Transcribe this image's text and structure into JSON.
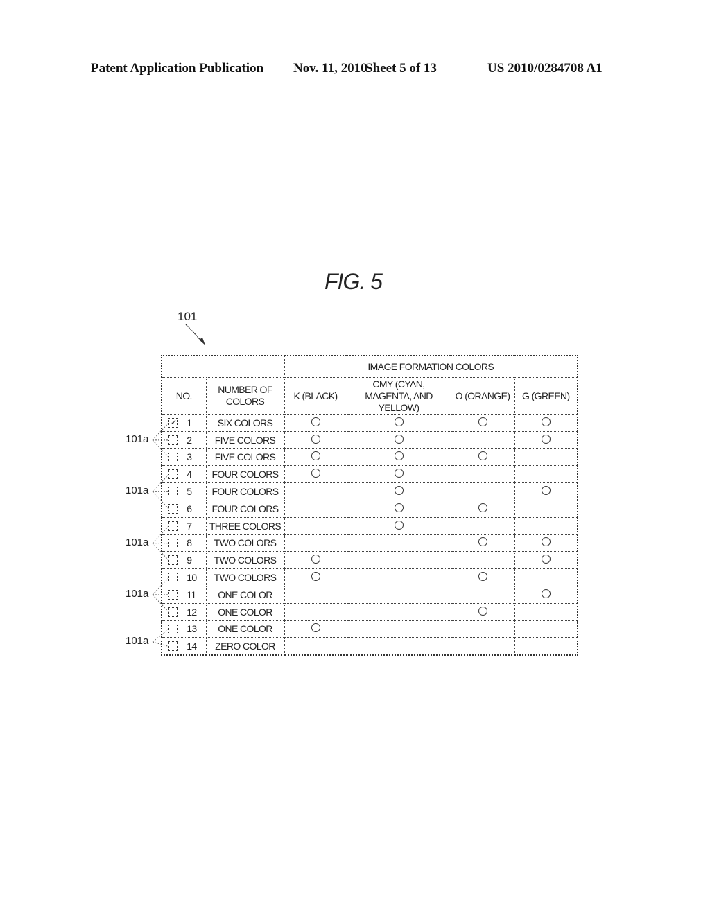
{
  "header": {
    "publication": "Patent Application Publication",
    "date": "Nov. 11, 2010",
    "sheet": "Sheet 5 of 13",
    "number": "US 2010/0284708 A1"
  },
  "figure": {
    "title": "FIG. 5",
    "ref_main": "101",
    "ref_checkbox": "101a"
  },
  "table": {
    "group_header": "IMAGE FORMATION COLORS",
    "columns": {
      "no": "NO.",
      "number_of_colors": "NUMBER OF COLORS",
      "k": "K (BLACK)",
      "cmy": "CMY (CYAN, MAGENTA, AND YELLOW)",
      "o": "O (ORANGE)",
      "g": "G (GREEN)"
    },
    "rows": [
      {
        "no": "1",
        "checked": true,
        "label": "SIX COLORS",
        "k": true,
        "cmy": true,
        "o": true,
        "g": true
      },
      {
        "no": "2",
        "checked": false,
        "label": "FIVE COLORS",
        "k": true,
        "cmy": true,
        "o": false,
        "g": true
      },
      {
        "no": "3",
        "checked": false,
        "label": "FIVE COLORS",
        "k": true,
        "cmy": true,
        "o": true,
        "g": false
      },
      {
        "no": "4",
        "checked": false,
        "label": "FOUR COLORS",
        "k": true,
        "cmy": true,
        "o": false,
        "g": false
      },
      {
        "no": "5",
        "checked": false,
        "label": "FOUR COLORS",
        "k": false,
        "cmy": true,
        "o": false,
        "g": true
      },
      {
        "no": "6",
        "checked": false,
        "label": "FOUR COLORS",
        "k": false,
        "cmy": true,
        "o": true,
        "g": false
      },
      {
        "no": "7",
        "checked": false,
        "label": "THREE COLORS",
        "k": false,
        "cmy": true,
        "o": false,
        "g": false
      },
      {
        "no": "8",
        "checked": false,
        "label": "TWO COLORS",
        "k": false,
        "cmy": false,
        "o": true,
        "g": true
      },
      {
        "no": "9",
        "checked": false,
        "label": "TWO COLORS",
        "k": true,
        "cmy": false,
        "o": false,
        "g": true
      },
      {
        "no": "10",
        "checked": false,
        "label": "TWO COLORS",
        "k": true,
        "cmy": false,
        "o": true,
        "g": false
      },
      {
        "no": "11",
        "checked": false,
        "label": "ONE COLOR",
        "k": false,
        "cmy": false,
        "o": false,
        "g": true
      },
      {
        "no": "12",
        "checked": false,
        "label": "ONE COLOR",
        "k": false,
        "cmy": false,
        "o": true,
        "g": false
      },
      {
        "no": "13",
        "checked": false,
        "label": "ONE COLOR",
        "k": true,
        "cmy": false,
        "o": false,
        "g": false
      },
      {
        "no": "14",
        "checked": false,
        "label": "ZERO COLOR",
        "k": false,
        "cmy": false,
        "o": false,
        "g": false
      }
    ]
  },
  "icons": {
    "checked": "✓",
    "present": "circle-mark"
  }
}
